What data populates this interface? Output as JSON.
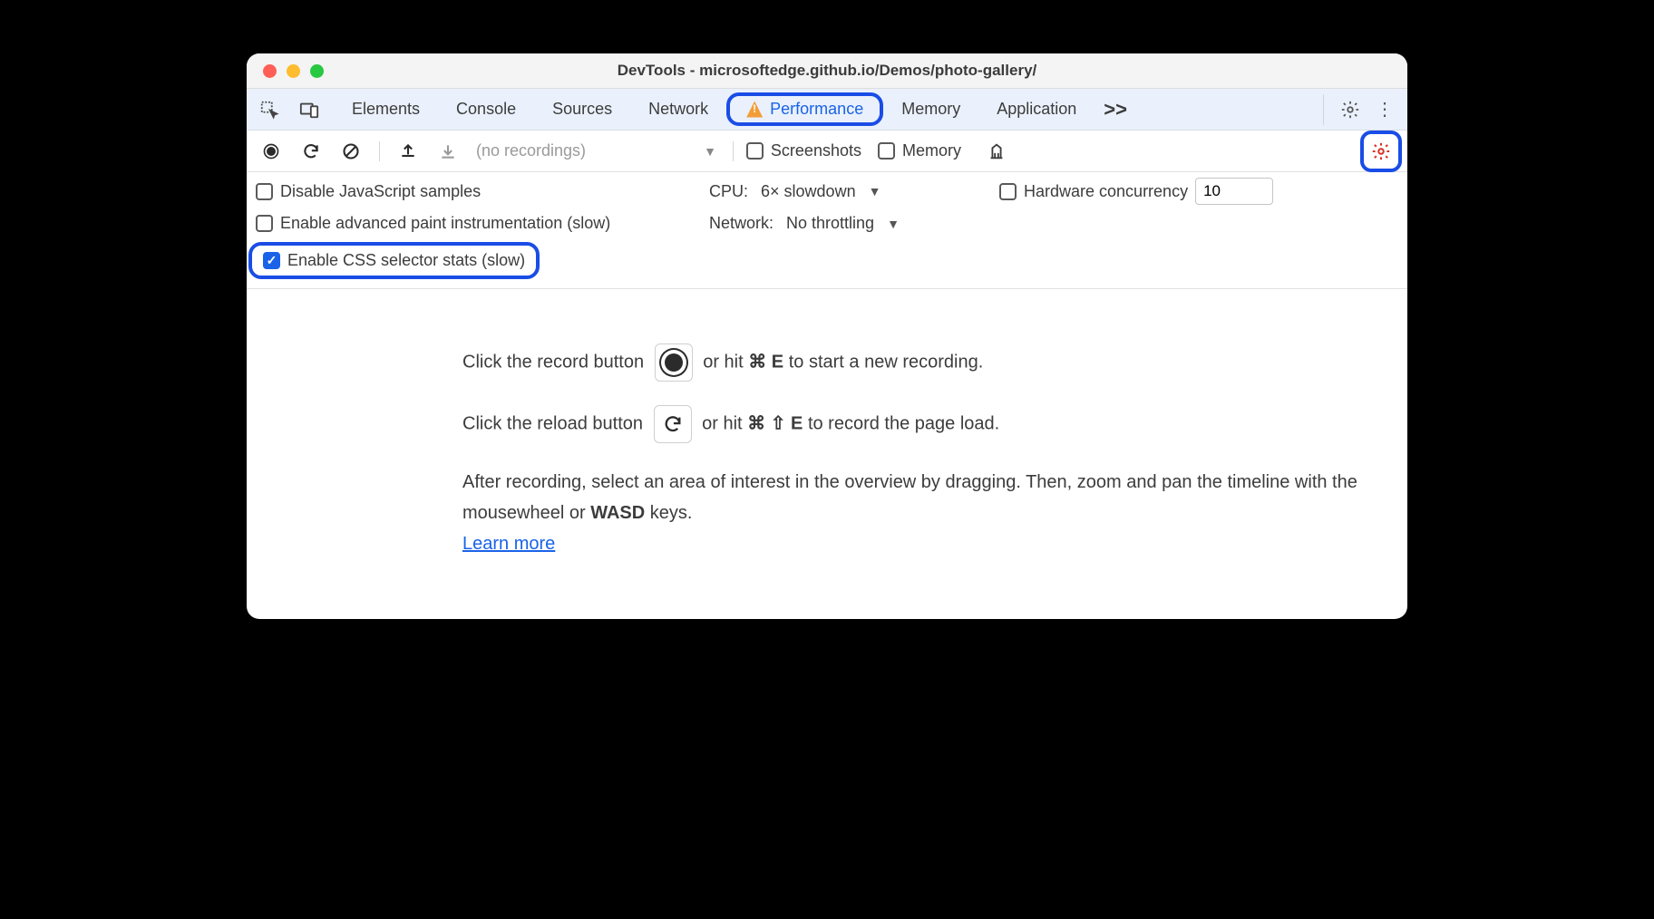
{
  "window": {
    "title": "DevTools - microsoftedge.github.io/Demos/photo-gallery/"
  },
  "tabs": {
    "items": [
      "Elements",
      "Console",
      "Sources",
      "Network",
      "Performance",
      "Memory",
      "Application"
    ],
    "active_index": 4,
    "overflow_label": ">>"
  },
  "toolbar": {
    "recordings_placeholder": "(no recordings)",
    "screenshots_label": "Screenshots",
    "memory_label": "Memory"
  },
  "settings": {
    "disable_js_label": "Disable JavaScript samples",
    "advanced_paint_label": "Enable advanced paint instrumentation (slow)",
    "css_stats_label": "Enable CSS selector stats (slow)",
    "cpu_label": "CPU:",
    "cpu_value": "6× slowdown",
    "network_label": "Network:",
    "network_value": "No throttling",
    "hw_label": "Hardware concurrency",
    "hw_value": "10"
  },
  "content": {
    "line1_a": "Click the record button ",
    "line1_b": " or hit ",
    "line1_key": "⌘ E",
    "line1_c": " to start a new recording.",
    "line2_a": "Click the reload button ",
    "line2_b": " or hit ",
    "line2_key": "⌘ ⇧ E",
    "line2_c": " to record the page load.",
    "line3": "After recording, select an area of interest in the overview by dragging. Then, zoom and pan the timeline with the mousewheel or ",
    "line3_bold": "WASD",
    "line3_end": " keys.",
    "learn_more": "Learn more"
  }
}
